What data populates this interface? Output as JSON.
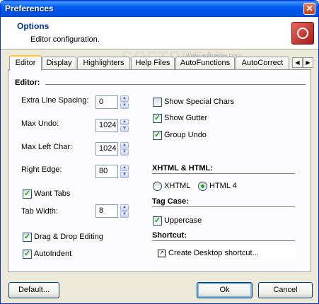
{
  "window": {
    "title": "Preferences"
  },
  "header": {
    "title": "Options",
    "subtitle": "Editor configuration.",
    "watermark": "SOFTPEDIA",
    "watermark_url": "www.softpedia.com"
  },
  "tabs": [
    "Editor",
    "Display",
    "Highlighters",
    "Help Files",
    "AutoFunctions",
    "AutoCorrect"
  ],
  "editor": {
    "section_title": "Editor:",
    "extra_line_spacing": {
      "label": "Extra Line Spacing:",
      "value": "0"
    },
    "max_undo": {
      "label": "Max Undo:",
      "value": "1024"
    },
    "max_left_char": {
      "label": "Max Left Char:",
      "value": "1024"
    },
    "right_edge": {
      "label": "Right Edge:",
      "value": "80"
    },
    "want_tabs": {
      "label": "Want Tabs",
      "checked": true
    },
    "tab_width": {
      "label": "Tab Width:",
      "value": "8"
    },
    "drag_drop": {
      "label": "Drag & Drop Editing",
      "checked": true
    },
    "auto_indent": {
      "label": "AutoIndent",
      "checked": true
    },
    "show_special_chars": {
      "label": "Show Special Chars",
      "checked": false
    },
    "show_gutter": {
      "label": "Show Gutter",
      "checked": true
    },
    "group_undo": {
      "label": "Group Undo",
      "checked": true
    }
  },
  "xhtml": {
    "title": "XHTML & HTML:",
    "options": [
      "XHTML",
      "HTML 4"
    ],
    "selected": "HTML 4"
  },
  "tag_case": {
    "title": "Tag Case:",
    "uppercase": {
      "label": "Uppercase",
      "checked": true
    }
  },
  "shortcut": {
    "title": "Shortcut:",
    "label": "Create Desktop shortcut..."
  },
  "buttons": {
    "default": "Default...",
    "ok": "Ok",
    "cancel": "Cancel"
  },
  "colors": {
    "title_bar": "#0054e3",
    "tab_highlight": "#ffc73c",
    "check_mark": "#21a121"
  }
}
